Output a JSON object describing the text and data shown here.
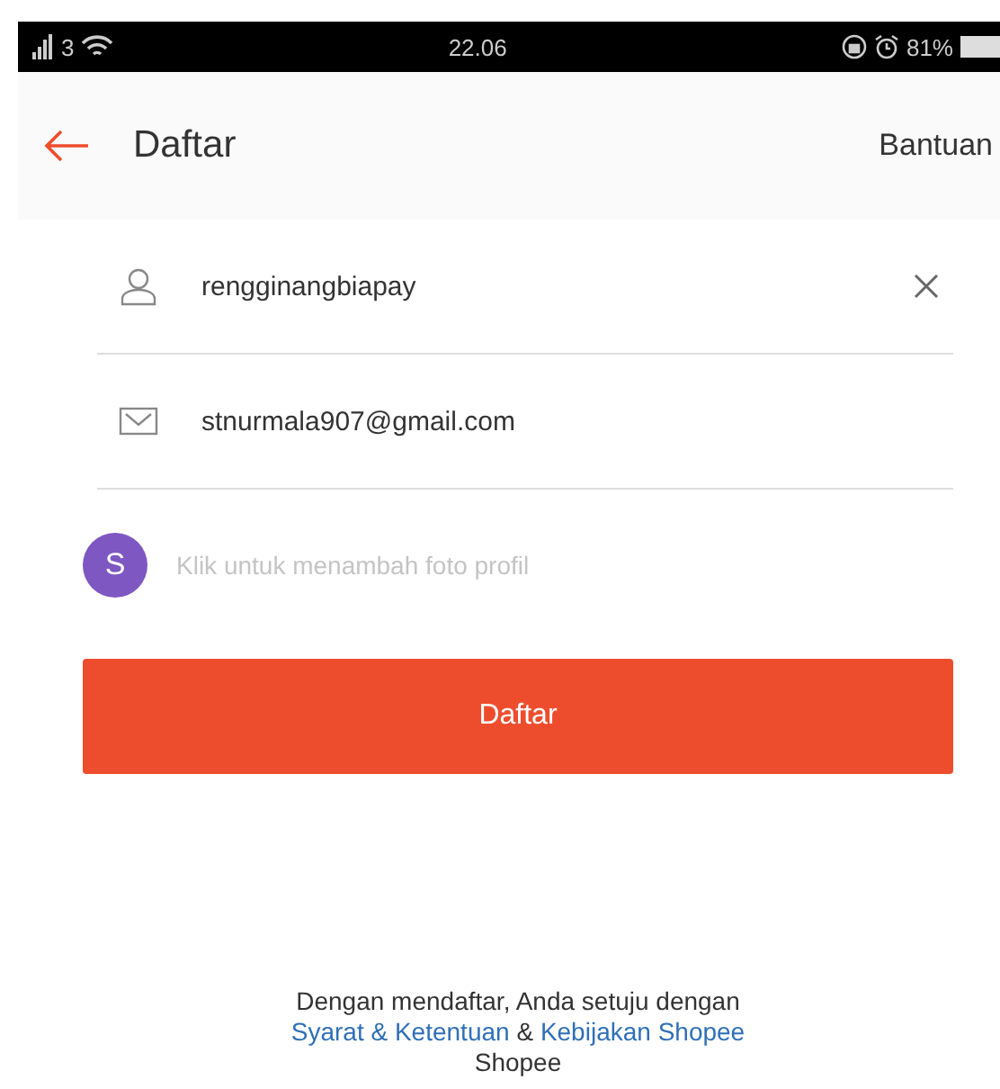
{
  "status_bar": {
    "network": "3",
    "time": "22.06",
    "battery": "81%"
  },
  "header": {
    "title": "Daftar",
    "help": "Bantuan"
  },
  "fields": [
    {
      "kind": "user",
      "value": "rengginangbiapay",
      "clearable": true
    },
    {
      "kind": "email",
      "value": "stnurmala907@gmail.com",
      "clearable": false
    }
  ],
  "avatar": {
    "initial": "S",
    "color": "#7e57c2",
    "hint": "Klik untuk menambah foto profil"
  },
  "submit_button": "Daftar",
  "footer": {
    "intro": "Dengan mendaftar, Anda setuju dengan",
    "terms_link": "Syarat & Ketentuan",
    "separator": "&",
    "policy_link": "Kebijakan Shopee",
    "tail": "Shopee"
  }
}
